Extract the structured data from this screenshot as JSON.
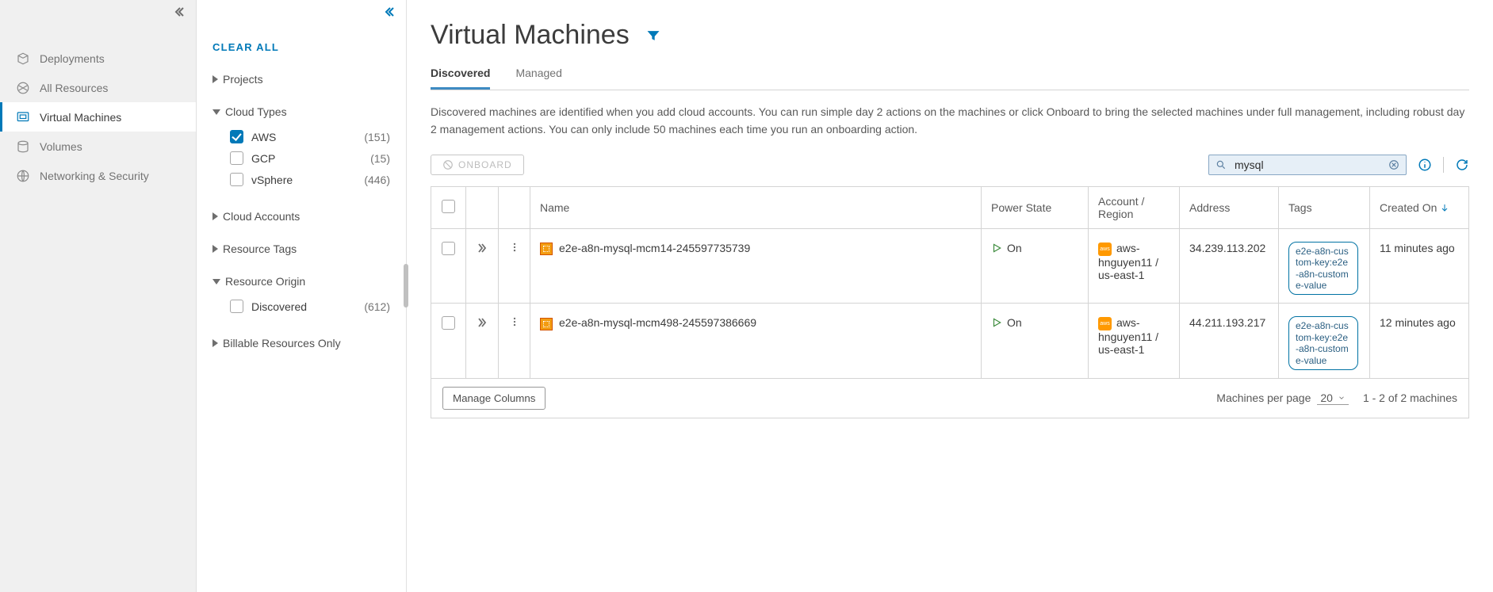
{
  "sidebar": {
    "items": [
      {
        "label": "Deployments"
      },
      {
        "label": "All Resources"
      },
      {
        "label": "Virtual Machines"
      },
      {
        "label": "Volumes"
      },
      {
        "label": "Networking & Security"
      }
    ]
  },
  "filters": {
    "clear": "CLEAR ALL",
    "projects": "Projects",
    "cloudTypes": {
      "label": "Cloud Types",
      "options": [
        {
          "name": "AWS",
          "count": "(151)",
          "checked": true
        },
        {
          "name": "GCP",
          "count": "(15)",
          "checked": false
        },
        {
          "name": "vSphere",
          "count": "(446)",
          "checked": false
        }
      ]
    },
    "cloudAccounts": "Cloud Accounts",
    "resourceTags": "Resource Tags",
    "resourceOrigin": {
      "label": "Resource Origin",
      "options": [
        {
          "name": "Discovered",
          "count": "(612)",
          "checked": false
        }
      ]
    },
    "billable": "Billable Resources Only"
  },
  "page": {
    "title": "Virtual Machines",
    "tabs": {
      "discovered": "Discovered",
      "managed": "Managed"
    },
    "description": "Discovered machines are identified when you add cloud accounts. You can run simple day 2 actions on the machines or click Onboard to bring the selected machines under full management, including robust day 2 management actions. You can only include 50 machines each time you run an onboarding action.",
    "onboard": "ONBOARD",
    "search": {
      "value": "mysql"
    },
    "columns": {
      "name": "Name",
      "power": "Power State",
      "account": "Account / Region",
      "address": "Address",
      "tags": "Tags",
      "created": "Created On"
    },
    "rows": [
      {
        "name": "e2e-a8n-mysql-mcm14-245597735739",
        "power": "On",
        "account": "aws-hnguyen11 / us-east-1",
        "address": "34.239.113.202",
        "tag": "e2e-a8n-custom-key:e2e-a8n-custome-value",
        "created": "11 minutes ago"
      },
      {
        "name": "e2e-a8n-mysql-mcm498-245597386669",
        "power": "On",
        "account": "aws-hnguyen11 / us-east-1",
        "address": "44.211.193.217",
        "tag": "e2e-a8n-custom-key:e2e-a8n-custome-value",
        "created": "12 minutes ago"
      }
    ],
    "footer": {
      "manageColumns": "Manage Columns",
      "perPageLabel": "Machines per page",
      "perPage": "20",
      "range": "1 - 2 of 2 machines"
    }
  }
}
